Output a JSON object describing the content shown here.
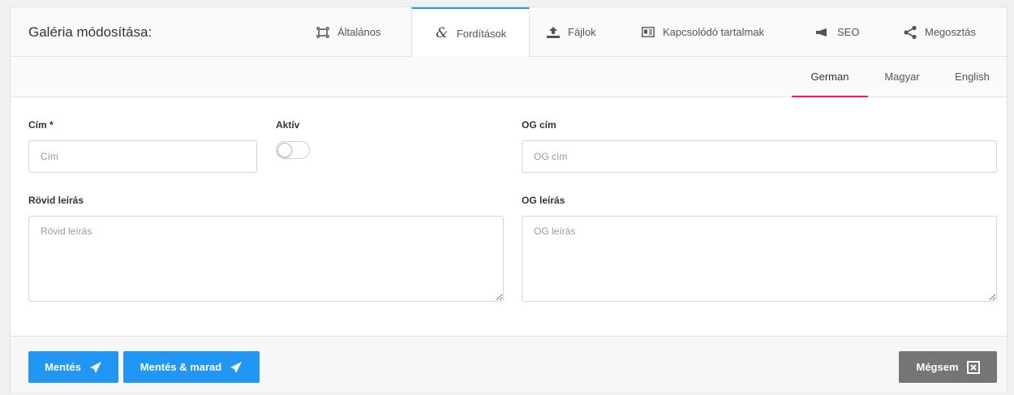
{
  "header": {
    "title": "Galéria módosítása:",
    "tabs": [
      {
        "label": "Általános",
        "icon": "frame-icon"
      },
      {
        "label": "Fordítások",
        "icon": "ampersand-icon"
      },
      {
        "label": "Fájlok",
        "icon": "upload-icon"
      },
      {
        "label": "Kapcsolódó tartalmak",
        "icon": "newspaper-icon"
      },
      {
        "label": "SEO",
        "icon": "megaphone-icon"
      },
      {
        "label": "Megosztás",
        "icon": "share-icon"
      }
    ],
    "active_tab": "Fordítások",
    "accent": "#2196f3"
  },
  "languages": {
    "items": [
      "German",
      "Magyar",
      "English"
    ],
    "active": "German",
    "accent": "#e91e63"
  },
  "form": {
    "title_label": "Cím *",
    "title_placeholder": "Cím",
    "active_label": "Aktív",
    "active_value": false,
    "og_title_label": "OG cím",
    "og_title_placeholder": "OG cím",
    "short_desc_label": "Rövid leírás",
    "short_desc_placeholder": "Rövid leírás",
    "og_desc_label": "OG leírás",
    "og_desc_placeholder": "OG leírás"
  },
  "footer": {
    "save_label": "Mentés",
    "save_stay_label": "Mentés & marad",
    "cancel_label": "Mégsem"
  }
}
